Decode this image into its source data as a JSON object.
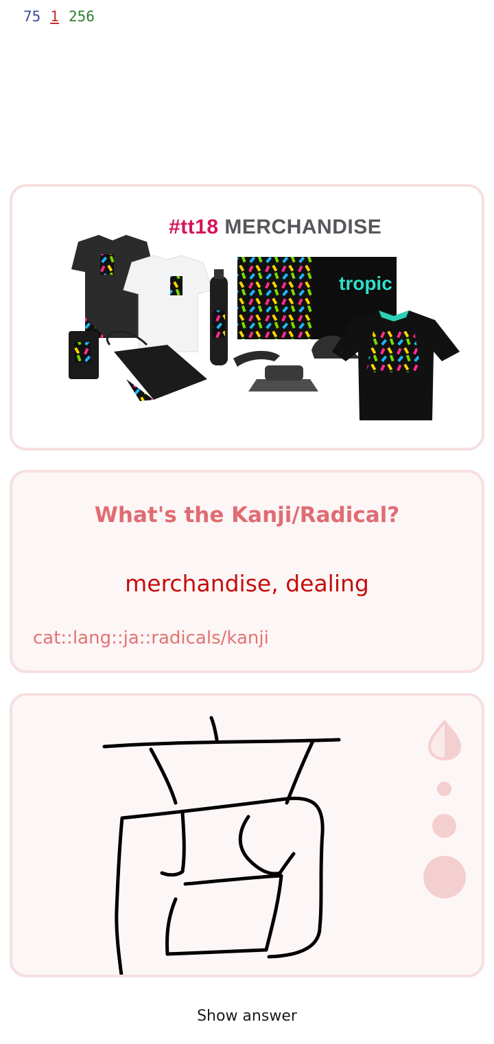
{
  "counts": {
    "new": "75",
    "learning": "1",
    "review": "256"
  },
  "image": {
    "title_tag": "#tt18",
    "title_text": "MERCHANDISE",
    "bottle_brand": "tropic",
    "colors": {
      "tag": "#d4145a",
      "title": "#55575b"
    }
  },
  "question": {
    "prompt": "What's the Kanji/Radical?",
    "meaning": "merchandise, dealing",
    "tags": "cat::lang::ja::radicals/kanji"
  },
  "drawing": {
    "tools": [
      "ink-color-icon",
      "brush-small-icon",
      "brush-medium-icon",
      "brush-large-icon"
    ]
  },
  "footer": {
    "show_answer": "Show answer"
  }
}
